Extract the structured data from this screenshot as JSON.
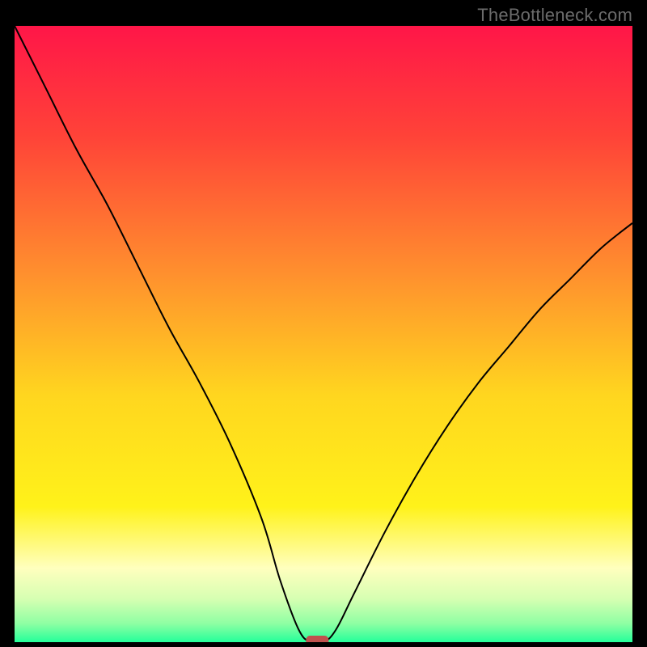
{
  "watermark": "TheBottleneck.com",
  "chart_data": {
    "type": "line",
    "title": "",
    "xlabel": "",
    "ylabel": "",
    "xlim": [
      0,
      100
    ],
    "ylim": [
      0,
      100
    ],
    "gradient_stops": [
      {
        "offset": 0,
        "color": "#ff1648"
      },
      {
        "offset": 0.18,
        "color": "#ff4338"
      },
      {
        "offset": 0.4,
        "color": "#ff8f2e"
      },
      {
        "offset": 0.6,
        "color": "#ffd61f"
      },
      {
        "offset": 0.78,
        "color": "#fff21a"
      },
      {
        "offset": 0.88,
        "color": "#ffffbe"
      },
      {
        "offset": 0.93,
        "color": "#d6ffb2"
      },
      {
        "offset": 0.97,
        "color": "#8effa3"
      },
      {
        "offset": 1.0,
        "color": "#24ff9a"
      }
    ],
    "series": [
      {
        "name": "bottleneck-curve",
        "x": [
          0,
          5,
          10,
          15,
          20,
          25,
          30,
          35,
          40,
          43,
          46,
          48,
          50,
          52,
          55,
          60,
          65,
          70,
          75,
          80,
          85,
          90,
          95,
          100
        ],
        "y": [
          100,
          90,
          80,
          71,
          61,
          51,
          42,
          32,
          20,
          10,
          2,
          0,
          0,
          2,
          8,
          18,
          27,
          35,
          42,
          48,
          54,
          59,
          64,
          68
        ]
      }
    ],
    "marker": {
      "x": 49,
      "y": 0,
      "shape": "rounded-rect"
    }
  }
}
